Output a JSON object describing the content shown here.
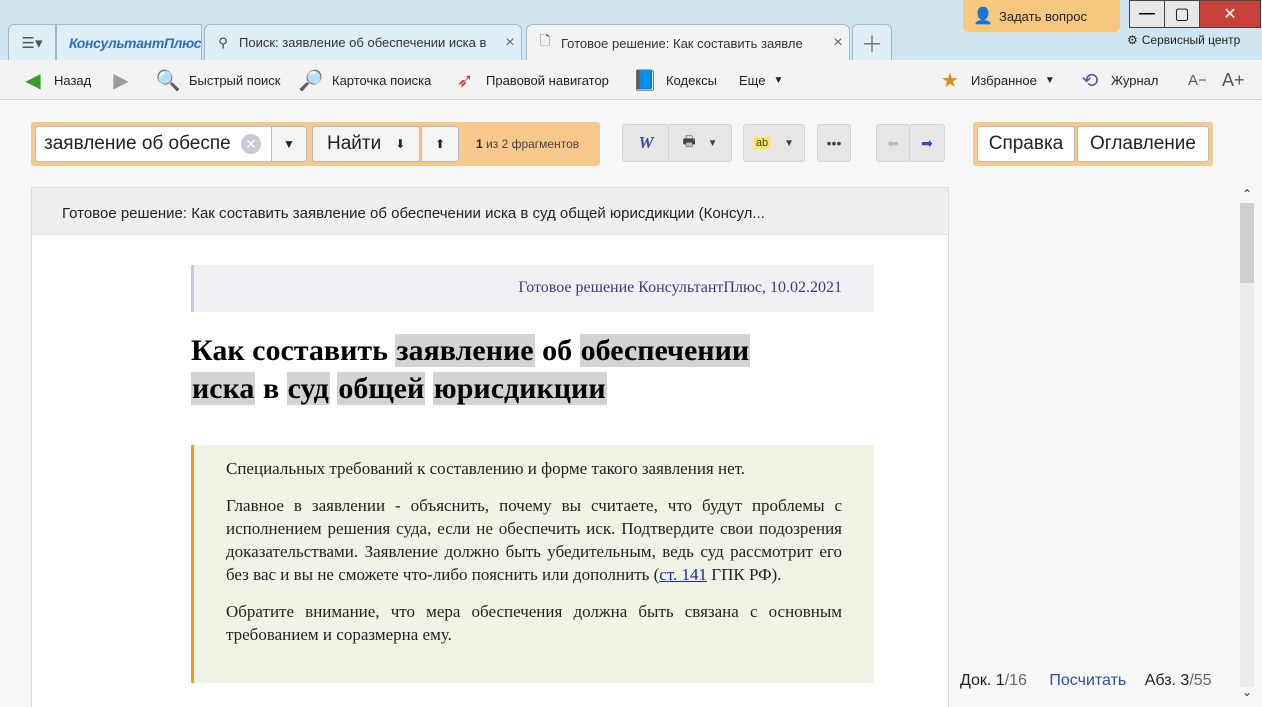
{
  "tabs": {
    "brand": "КонсультантПлюс",
    "search_tab": "Поиск: заявление об обеспечении иска в",
    "doc_tab": "Готовое решение: Как составить заявле"
  },
  "window": {
    "ask_label": "Задать вопрос",
    "service_center": "Сервисный центр"
  },
  "toolbar": {
    "back": "Назад",
    "quick_search": "Быстрый поиск",
    "search_card": "Карточка поиска",
    "navigator": "Правовой навигатор",
    "codes": "Кодексы",
    "more": "Еще",
    "favorites": "Избранное",
    "journal": "Журнал",
    "font_smaller": "A−",
    "font_bigger": "A+"
  },
  "search": {
    "value": "заявление об обеспе",
    "find_label": "Найти",
    "fragments_current": "1",
    "fragments_text": "из 2 фрагментов"
  },
  "side": {
    "help": "Справка",
    "contents": "Оглавление"
  },
  "document": {
    "header": "Готовое решение: Как составить заявление об обеспечении иска в суд общей юрисдикции (Консул...",
    "meta": "Готовое решение КонсультантПлюс, 10.02.2021",
    "title_parts": [
      "Как составить",
      "заявление",
      "об",
      "обеспечении",
      "иска",
      "в",
      "суд",
      "общей",
      "юрисдикции"
    ],
    "para1": "Специальных требований к составлению и форме такого заявления нет.",
    "para2_text": "Главное в заявлении - объяснить, почему вы считаете, что будут проблемы с исполнением решения суда, если не обеспечить иск. Подтвердите свои подозрения доказательствами. Заявление должно быть убедительным, ведь суд рассмотрит его без вас и вы не сможете что-либо пояснить или дополнить (",
    "para2_link": "ст. 141",
    "para2_tail": " ГПК РФ).",
    "para3": "Обратите внимание, что мера обеспечения должна быть связана с основным требованием и соразмерна ему."
  },
  "status": {
    "doc_label": "Док. 1",
    "doc_total": "/16",
    "count": "Посчитать",
    "abz_label": "Абз. 3",
    "abz_total": "/55"
  }
}
